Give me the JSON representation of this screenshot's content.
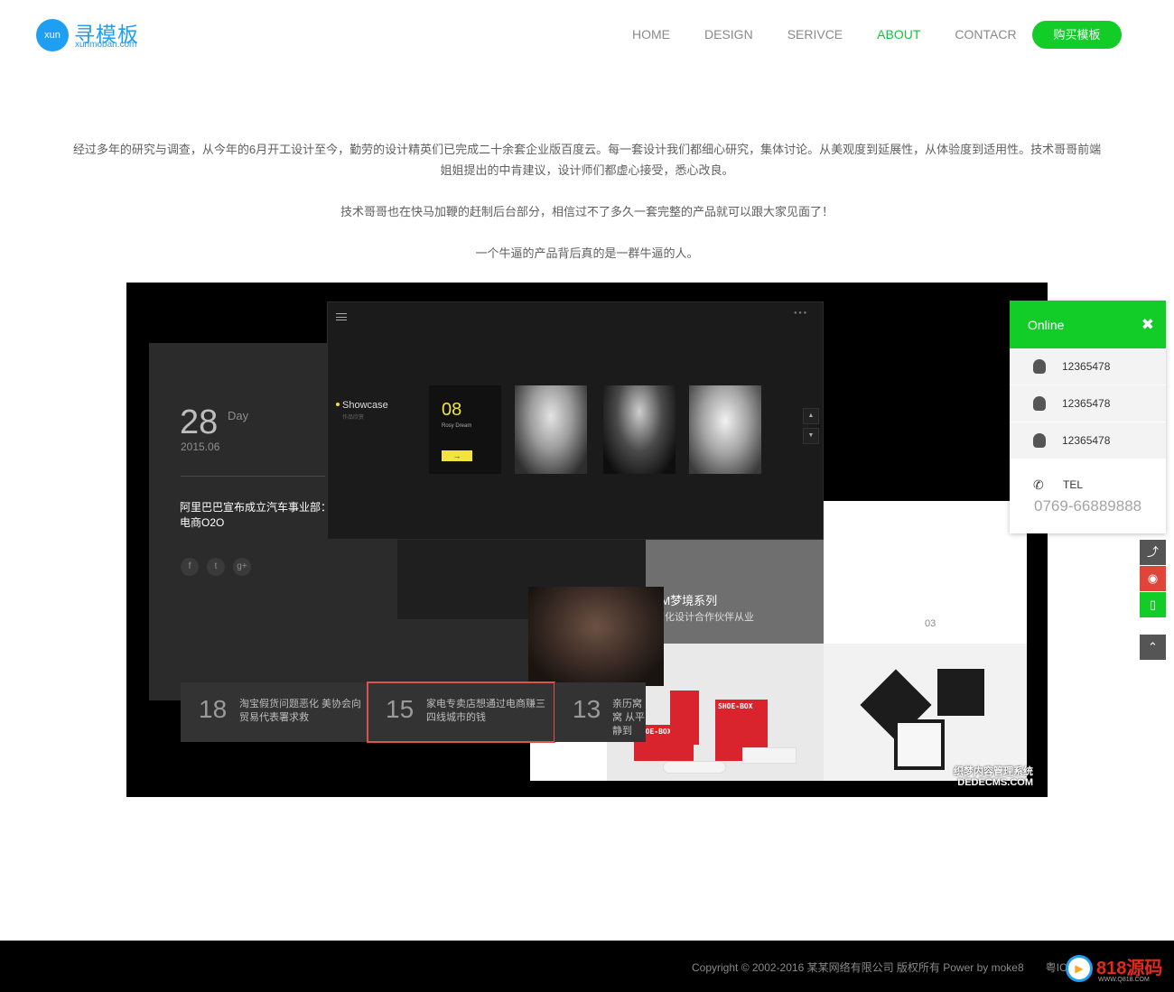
{
  "header": {
    "logo_badge": "xun",
    "logo_cn": "寻模板",
    "logo_en": "xunmoban.com",
    "nav": [
      "HOME",
      "DESIGN",
      "SERIVCE",
      "ABOUT",
      "CONTACR"
    ],
    "active_nav": "ABOUT",
    "buy_label": "购买模板",
    "accent": "#12cc28"
  },
  "intro": {
    "p1": "经过多年的研究与调查，从今年的6月开工设计至今，勤劳的设计精英们已完成二十余套企业版百度云。每一套设计我们都细心研究，集体讨论。从美观度到延展性，从体验度到适用性。技术哥哥前端姐姐提出的中肯建议，设计师们都虚心接受，悉心改良。",
    "p2": "技术哥哥也在快马加鞭的赶制后台部分，相信过不了多久一套完整的产品就可以跟大家见面了！",
    "p3": "一个牛逼的产品背后真的是一群牛逼的人。"
  },
  "showcase": {
    "day_num": "28",
    "day_label": "Day",
    "date": "2015.06",
    "news_title": "阿里巴巴宣布成立汽车事业部：电商O2O",
    "social": [
      "f",
      "t",
      "g+"
    ],
    "cells": [
      {
        "num": "18",
        "text": "淘宝假货问题恶化 美协会向贸易代表署求救"
      },
      {
        "num": "15",
        "text": "家电专卖店想通过电商赚三四线城市的钱"
      },
      {
        "num": "13",
        "text": "亲历窝窝 从平静到"
      }
    ],
    "slider_label": "Showcase",
    "slider_sub": "作品欣赏",
    "tile_num": "08",
    "tile_caption": "Rosy Dream",
    "tile_arrow": "→",
    "gray_title": "EAM梦境系列",
    "gray_sub": "的深化设计合作伙伴从业",
    "num03": "03",
    "shoe_text": "SHOE-BOX",
    "watermark_cn": "织梦内容管理系统",
    "watermark_en": "DEDECMS.COM"
  },
  "online": {
    "title": "Online",
    "close": "✖",
    "qq": [
      "12365478",
      "12365478",
      "12365478"
    ],
    "tel_label": "TEL",
    "tel_number": "0769-66889888"
  },
  "side_buttons": [
    "⤴",
    "◉",
    "▯",
    "⌃"
  ],
  "footer": {
    "copyright": "Copyright © 2002-2016 某某网络有限公司 版权所有 Power by moke8　　粤ICP备",
    "brand_name": "818源码",
    "brand_url": "WWW.Q818.COM",
    "brand_play": "▶"
  }
}
